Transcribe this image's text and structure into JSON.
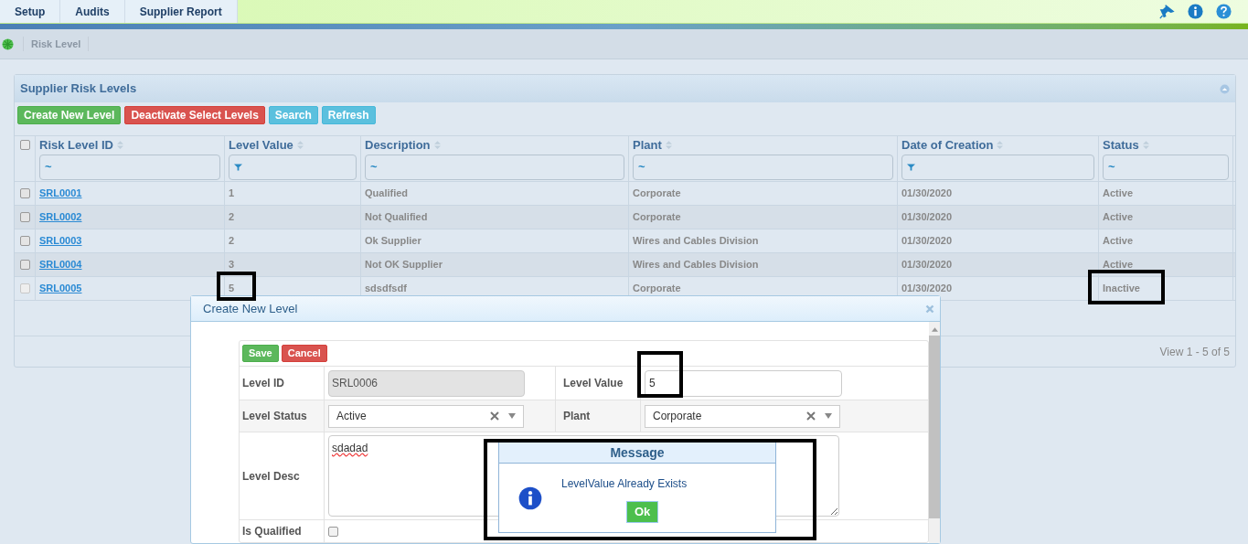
{
  "top_tabs": [
    {
      "label": "Setup"
    },
    {
      "label": "Audits"
    },
    {
      "label": "Supplier Report"
    }
  ],
  "breadcrumb": "Risk Level",
  "panel": {
    "title": "Supplier Risk Levels",
    "buttons": [
      {
        "label": "Create New Level",
        "kind": "success"
      },
      {
        "label": "Deactivate Select Levels",
        "kind": "danger"
      },
      {
        "label": "Search",
        "kind": "info"
      },
      {
        "label": "Refresh",
        "kind": "info"
      }
    ],
    "select_all_checked": false,
    "columns": [
      {
        "label": "Risk Level ID",
        "filter_funnel": false,
        "filter_text": "~"
      },
      {
        "label": "Level Value",
        "filter_funnel": true
      },
      {
        "label": "Description",
        "filter_funnel": false,
        "filter_text": "~"
      },
      {
        "label": "Plant",
        "filter_funnel": false,
        "filter_text": "~"
      },
      {
        "label": "Date of Creation",
        "filter_funnel": true
      },
      {
        "label": "Status",
        "filter_funnel": false,
        "filter_text": "~"
      }
    ],
    "rows": [
      {
        "cells": [
          "SRL0001",
          "1",
          "Qualified",
          "Corporate",
          "01/30/2020",
          "Active"
        ],
        "disabled": false
      },
      {
        "cells": [
          "SRL0002",
          "2",
          "Not Qualified",
          "Corporate",
          "01/30/2020",
          "Active"
        ],
        "disabled": false
      },
      {
        "cells": [
          "SRL0003",
          "2",
          "Ok Supplier",
          "Wires and Cables Division",
          "01/30/2020",
          "Active"
        ],
        "disabled": false
      },
      {
        "cells": [
          "SRL0004",
          "3",
          "Not OK Supplier",
          "Wires and Cables Division",
          "01/30/2020",
          "Active"
        ],
        "disabled": false
      },
      {
        "cells": [
          "SRL0005",
          "5",
          "sdsdfsdf",
          "Corporate",
          "01/30/2020",
          "Inactive"
        ],
        "disabled": true
      }
    ],
    "pager": "View 1 - 5 of 5"
  },
  "dialog": {
    "title": "Create New Level",
    "buttons": [
      {
        "label": "Save",
        "kind": "success"
      },
      {
        "label": "Cancel",
        "kind": "danger"
      }
    ],
    "level_id": {
      "label": "Level ID",
      "value": "SRL0006",
      "disabled": true
    },
    "level_value": {
      "label": "Level Value",
      "value": "5"
    },
    "level_status": {
      "label": "Level Status",
      "value": "Active"
    },
    "plant": {
      "label": "Plant",
      "value": "Corporate"
    },
    "level_desc": {
      "label": "Level Desc",
      "value": "sdadad"
    },
    "is_qualified": {
      "label": "Is Qualified",
      "checked": false
    }
  },
  "message": {
    "title": "Message",
    "text": "LevelValue Already Exists",
    "button": "Ok"
  }
}
